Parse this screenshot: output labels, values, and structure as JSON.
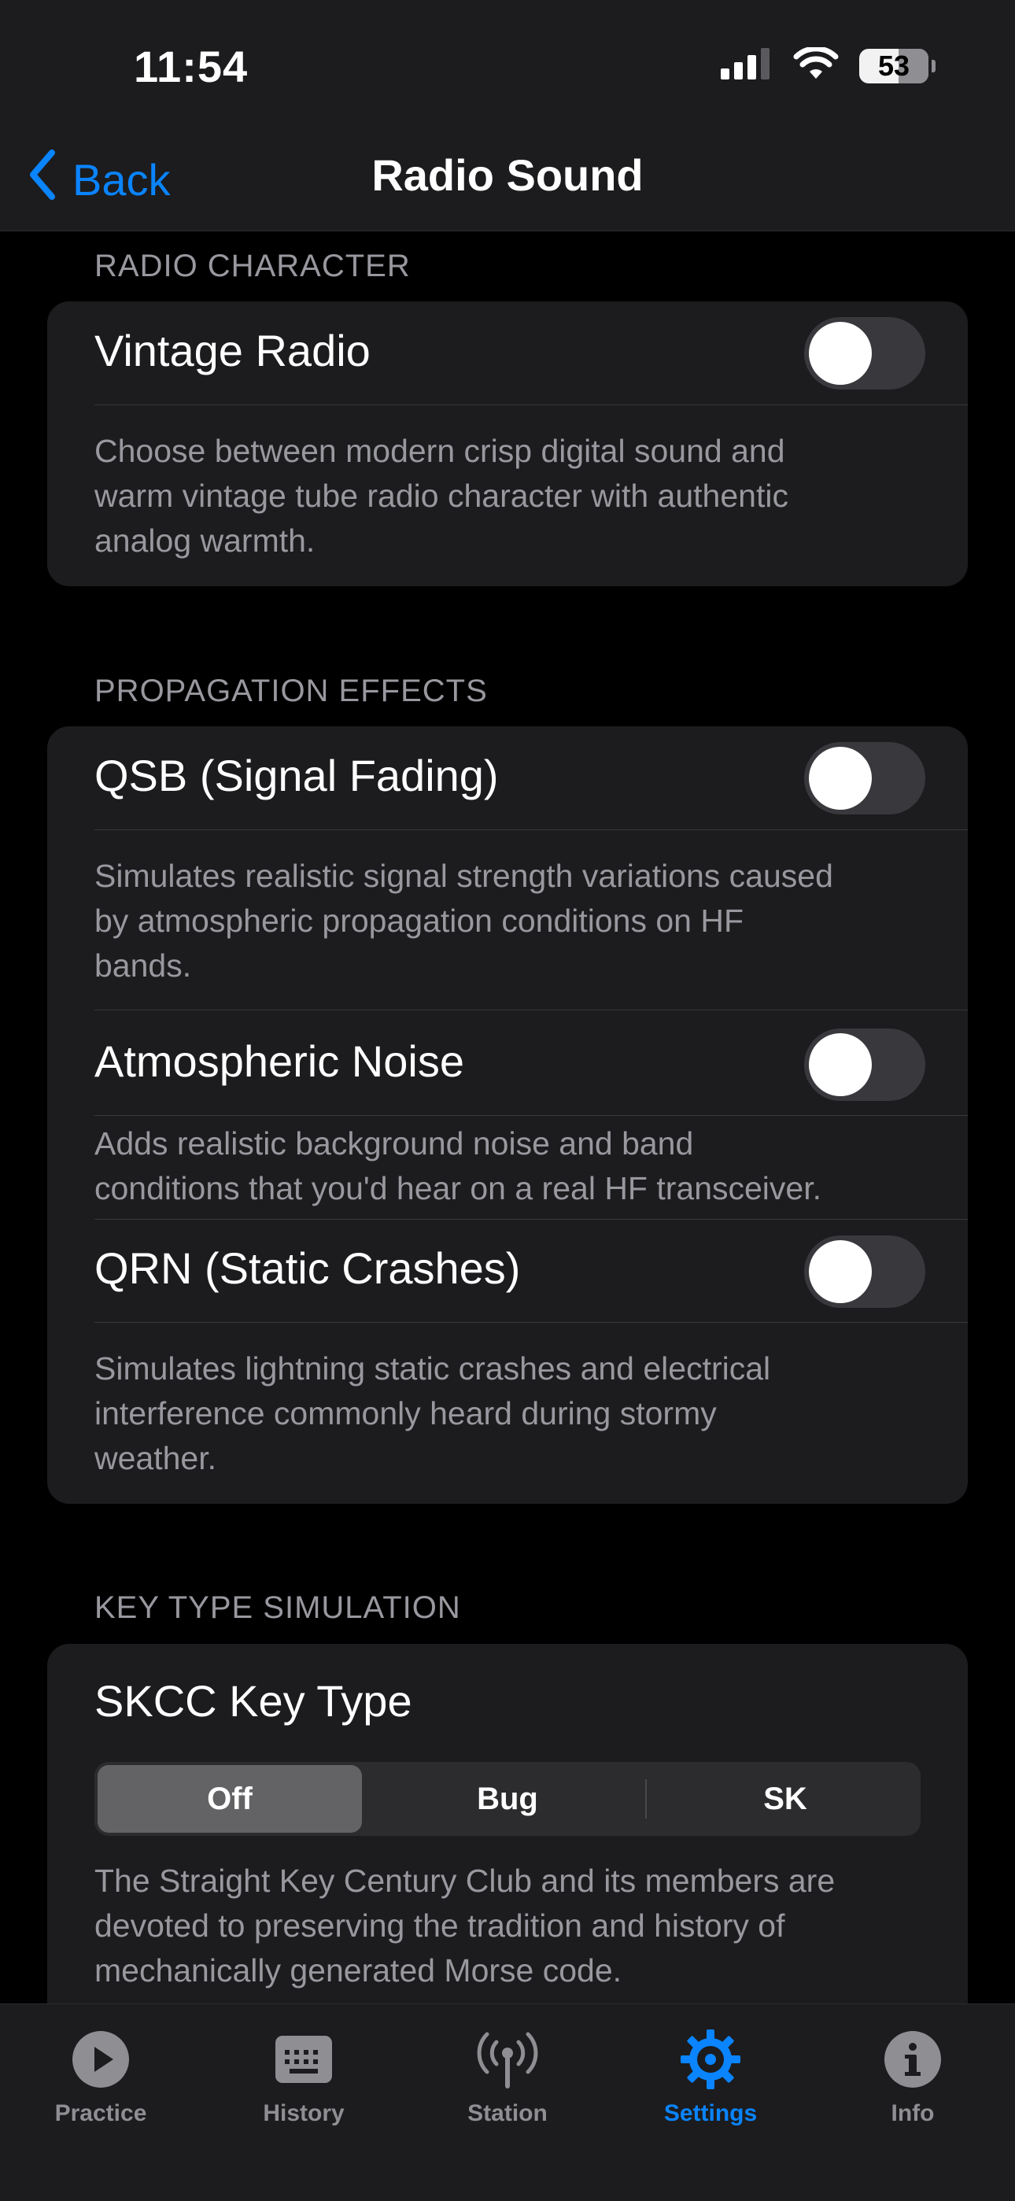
{
  "status_bar": {
    "time": "11:54",
    "battery": "53"
  },
  "nav": {
    "back_label": "Back",
    "title": "Radio Sound"
  },
  "sections": {
    "radio_character": {
      "header": "RADIO CHARACTER",
      "vintage": {
        "title": "Vintage Radio",
        "on": false,
        "desc": [
          "Choose between modern crisp digital sound and",
          "warm vintage tube radio character with authentic",
          "analog warmth."
        ]
      }
    },
    "propagation": {
      "header": "PROPAGATION EFFECTS",
      "qsb": {
        "title": "QSB (Signal Fading)",
        "on": false,
        "desc": [
          "Simulates realistic signal strength variations caused",
          "by atmospheric propagation conditions on HF",
          "bands."
        ]
      },
      "noise": {
        "title": "Atmospheric Noise",
        "on": false,
        "desc": [
          "Adds realistic background noise and band",
          "conditions that you'd hear on a real HF transceiver."
        ]
      },
      "qrn": {
        "title": "QRN (Static Crashes)",
        "on": false,
        "desc": [
          "Simulates lightning static crashes and electrical",
          "interference commonly heard during stormy",
          "weather."
        ]
      }
    },
    "key_type": {
      "header": "KEY TYPE SIMULATION",
      "title": "SKCC Key Type",
      "options": [
        "Off",
        "Bug",
        "SK"
      ],
      "selected": "Off",
      "desc": [
        "The Straight Key Century Club and its members are",
        "devoted to preserving the tradition and history of",
        "mechanically generated Morse code."
      ]
    }
  },
  "tabs": [
    {
      "label": "Practice",
      "icon": "play-circle-icon"
    },
    {
      "label": "History",
      "icon": "keyboard-icon"
    },
    {
      "label": "Station",
      "icon": "antenna-icon"
    },
    {
      "label": "Settings",
      "icon": "gear-icon",
      "active": true
    },
    {
      "label": "Info",
      "icon": "info-circle-icon"
    }
  ],
  "colors": {
    "accent": "#0a84ff",
    "background": "#000000",
    "card": "#1c1c1e",
    "secondary_text": "#98989f"
  }
}
